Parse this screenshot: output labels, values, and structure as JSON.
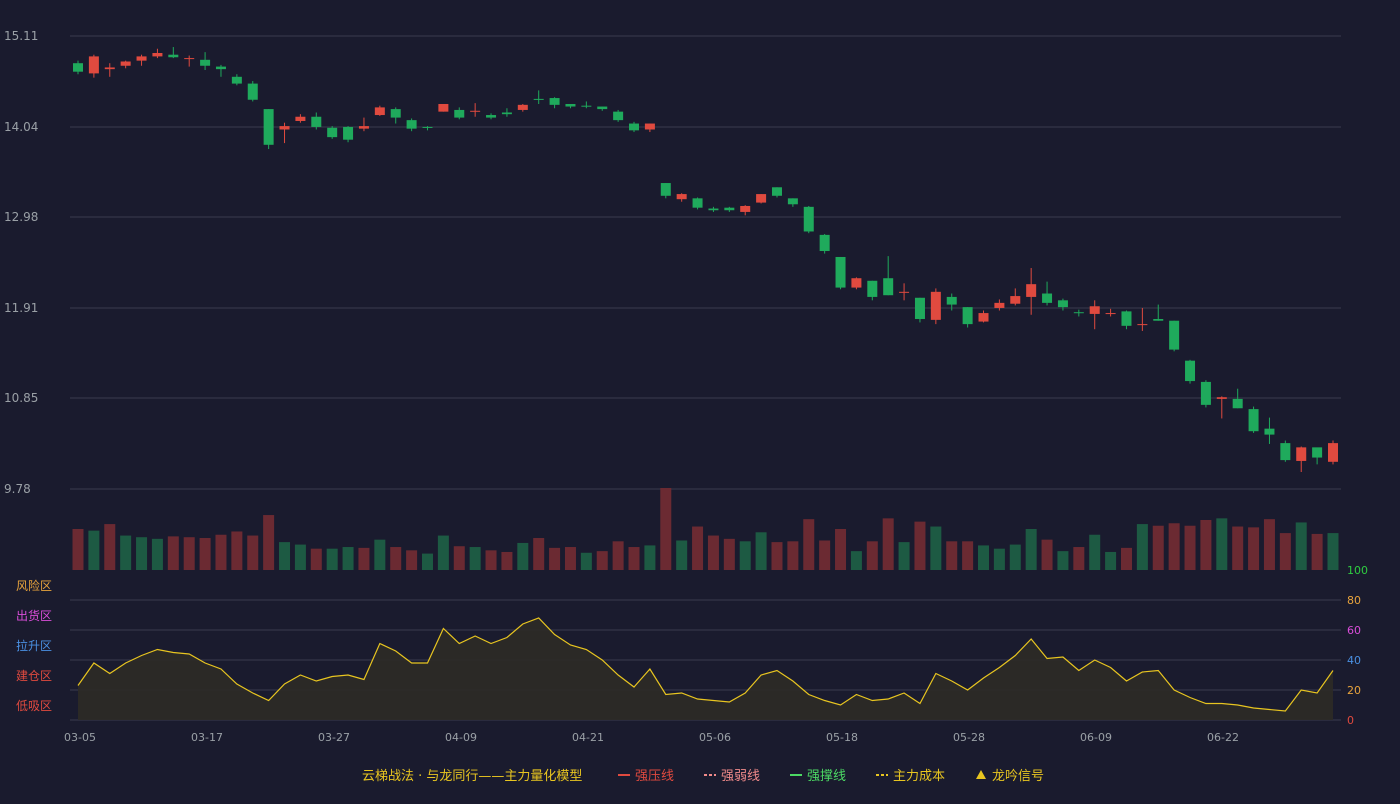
{
  "colors": {
    "background": "#1a1b2e",
    "grid": "#3a3b4e",
    "axis_text": "#9aa0a6",
    "up": "#e04a3f",
    "down": "#1faa5c",
    "vol_up": "#6b2a32",
    "vol_down": "#1d5a43",
    "osc_line": "#e8c520",
    "osc_fill": "#2e2b26"
  },
  "chart_data": [
    {
      "type": "candlestick",
      "title": "",
      "ylim": [
        9.78,
        15.11
      ],
      "yticks": [
        "15.11",
        "14.04",
        "12.98",
        "11.91",
        "10.85",
        "9.78"
      ],
      "grid": true,
      "candles": [
        [
          14.79,
          14.69,
          14.82,
          14.66
        ],
        [
          14.67,
          14.87,
          14.89,
          14.62
        ],
        [
          14.72,
          14.74,
          14.79,
          14.63
        ],
        [
          14.76,
          14.81,
          14.82,
          14.73
        ],
        [
          14.82,
          14.87,
          14.89,
          14.76
        ],
        [
          14.87,
          14.91,
          14.96,
          14.85
        ],
        [
          14.89,
          14.86,
          14.98,
          14.85
        ],
        [
          14.85,
          14.85,
          14.88,
          14.75
        ],
        [
          14.83,
          14.76,
          14.92,
          14.71
        ],
        [
          14.75,
          14.72,
          14.77,
          14.63
        ],
        [
          14.63,
          14.55,
          14.66,
          14.53
        ],
        [
          14.55,
          14.36,
          14.58,
          14.34
        ],
        [
          14.25,
          13.83,
          14.25,
          13.78
        ],
        [
          14.01,
          14.05,
          14.09,
          13.85
        ],
        [
          14.11,
          14.16,
          14.19,
          14.09
        ],
        [
          14.16,
          14.04,
          14.21,
          14.01
        ],
        [
          14.03,
          13.92,
          14.05,
          13.9
        ],
        [
          14.04,
          13.89,
          14.05,
          13.86
        ],
        [
          14.02,
          14.05,
          14.15,
          13.99
        ],
        [
          14.18,
          14.27,
          14.29,
          14.17
        ],
        [
          14.25,
          14.15,
          14.27,
          14.08
        ],
        [
          14.12,
          14.02,
          14.14,
          13.99
        ],
        [
          14.04,
          14.03,
          14.05,
          14.0
        ],
        [
          14.22,
          14.31,
          14.31,
          14.22
        ],
        [
          14.24,
          14.15,
          14.27,
          14.13
        ],
        [
          14.22,
          14.23,
          14.32,
          14.16
        ],
        [
          14.18,
          14.15,
          14.2,
          14.13
        ],
        [
          14.21,
          14.19,
          14.26,
          14.16
        ],
        [
          14.24,
          14.3,
          14.31,
          14.22
        ],
        [
          14.37,
          14.36,
          14.47,
          14.31
        ],
        [
          14.38,
          14.3,
          14.39,
          14.26
        ],
        [
          14.31,
          14.28,
          14.3,
          14.26
        ],
        [
          14.29,
          14.28,
          14.34,
          14.26
        ],
        [
          14.28,
          14.25,
          14.28,
          14.23
        ],
        [
          14.22,
          14.12,
          14.24,
          14.1
        ],
        [
          14.08,
          14.0,
          14.1,
          13.98
        ],
        [
          14.01,
          14.08,
          14.08,
          13.98
        ],
        [
          13.38,
          13.23,
          13.38,
          13.2
        ],
        [
          13.19,
          13.25,
          13.26,
          13.16
        ],
        [
          13.2,
          13.09,
          13.21,
          13.07
        ],
        [
          13.08,
          13.06,
          13.1,
          13.04
        ],
        [
          13.09,
          13.06,
          13.1,
          13.04
        ],
        [
          13.04,
          13.11,
          13.12,
          13.0
        ],
        [
          13.15,
          13.25,
          13.25,
          13.14
        ],
        [
          13.33,
          13.23,
          13.33,
          13.21
        ],
        [
          13.2,
          13.13,
          13.2,
          13.1
        ],
        [
          13.1,
          12.81,
          13.11,
          12.79
        ],
        [
          12.77,
          12.58,
          12.78,
          12.55
        ],
        [
          12.51,
          12.15,
          12.51,
          12.13
        ],
        [
          12.15,
          12.26,
          12.27,
          12.13
        ],
        [
          12.23,
          12.04,
          12.23,
          12.0
        ],
        [
          12.26,
          12.06,
          12.52,
          12.06
        ],
        [
          12.1,
          12.1,
          12.2,
          12.0
        ],
        [
          12.03,
          11.78,
          12.03,
          11.74
        ],
        [
          11.77,
          12.1,
          12.14,
          11.72
        ],
        [
          12.04,
          11.95,
          12.08,
          11.88
        ],
        [
          11.92,
          11.72,
          11.92,
          11.68
        ],
        [
          11.75,
          11.85,
          11.88,
          11.74
        ],
        [
          11.91,
          11.97,
          12.01,
          11.88
        ],
        [
          11.96,
          12.05,
          12.14,
          11.94
        ],
        [
          12.04,
          12.19,
          12.38,
          11.83
        ],
        [
          12.08,
          11.97,
          12.22,
          11.94
        ],
        [
          12.0,
          11.92,
          12.02,
          11.88
        ],
        [
          11.86,
          11.85,
          11.89,
          11.81
        ],
        [
          11.84,
          11.93,
          12.0,
          11.66
        ],
        [
          11.85,
          11.85,
          11.9,
          11.81
        ],
        [
          11.87,
          11.7,
          11.88,
          11.66
        ],
        [
          11.72,
          11.72,
          11.91,
          11.64
        ],
        [
          11.78,
          11.76,
          11.95,
          11.76
        ],
        [
          11.76,
          11.42,
          11.76,
          11.4
        ],
        [
          11.29,
          11.05,
          11.3,
          11.02
        ],
        [
          11.04,
          10.77,
          11.06,
          10.74
        ],
        [
          10.84,
          10.86,
          10.87,
          10.61
        ],
        [
          10.84,
          10.73,
          10.96,
          10.73
        ],
        [
          10.72,
          10.46,
          10.75,
          10.44
        ],
        [
          10.49,
          10.42,
          10.62,
          10.31
        ],
        [
          10.32,
          10.12,
          10.35,
          10.1
        ],
        [
          10.11,
          10.27,
          10.28,
          9.98
        ],
        [
          10.27,
          10.15,
          10.26,
          10.07
        ],
        [
          10.1,
          10.32,
          10.35,
          10.07
        ]
      ]
    },
    {
      "type": "bar",
      "title": "",
      "values": [
        [
          0.5,
          1
        ],
        [
          0.48,
          0
        ],
        [
          0.56,
          1
        ],
        [
          0.42,
          0
        ],
        [
          0.4,
          0
        ],
        [
          0.38,
          0
        ],
        [
          0.41,
          1
        ],
        [
          0.4,
          1
        ],
        [
          0.39,
          1
        ],
        [
          0.43,
          1
        ],
        [
          0.47,
          1
        ],
        [
          0.42,
          1
        ],
        [
          0.67,
          1
        ],
        [
          0.34,
          0
        ],
        [
          0.31,
          0
        ],
        [
          0.26,
          1
        ],
        [
          0.26,
          0
        ],
        [
          0.28,
          0
        ],
        [
          0.27,
          1
        ],
        [
          0.37,
          0
        ],
        [
          0.28,
          1
        ],
        [
          0.24,
          1
        ],
        [
          0.2,
          0
        ],
        [
          0.42,
          0
        ],
        [
          0.29,
          1
        ],
        [
          0.28,
          0
        ],
        [
          0.24,
          1
        ],
        [
          0.22,
          1
        ],
        [
          0.33,
          0
        ],
        [
          0.39,
          1
        ],
        [
          0.27,
          1
        ],
        [
          0.28,
          1
        ],
        [
          0.21,
          0
        ],
        [
          0.23,
          1
        ],
        [
          0.35,
          1
        ],
        [
          0.28,
          1
        ],
        [
          0.3,
          0
        ],
        [
          1.0,
          1
        ],
        [
          0.36,
          0
        ],
        [
          0.53,
          1
        ],
        [
          0.42,
          1
        ],
        [
          0.38,
          1
        ],
        [
          0.35,
          0
        ],
        [
          0.46,
          0
        ],
        [
          0.34,
          1
        ],
        [
          0.35,
          1
        ],
        [
          0.62,
          1
        ],
        [
          0.36,
          1
        ],
        [
          0.5,
          1
        ],
        [
          0.23,
          0
        ],
        [
          0.35,
          1
        ],
        [
          0.63,
          1
        ],
        [
          0.34,
          0
        ],
        [
          0.59,
          1
        ],
        [
          0.53,
          0
        ],
        [
          0.35,
          1
        ],
        [
          0.35,
          1
        ],
        [
          0.3,
          0
        ],
        [
          0.26,
          0
        ],
        [
          0.31,
          0
        ],
        [
          0.5,
          0
        ],
        [
          0.37,
          1
        ],
        [
          0.23,
          0
        ],
        [
          0.28,
          1
        ],
        [
          0.43,
          0
        ],
        [
          0.22,
          0
        ],
        [
          0.27,
          1
        ],
        [
          0.56,
          0
        ],
        [
          0.54,
          1
        ],
        [
          0.57,
          1
        ],
        [
          0.54,
          1
        ],
        [
          0.61,
          1
        ],
        [
          0.63,
          0
        ],
        [
          0.53,
          1
        ],
        [
          0.52,
          1
        ],
        [
          0.62,
          1
        ],
        [
          0.45,
          1
        ],
        [
          0.58,
          0
        ],
        [
          0.44,
          1
        ],
        [
          0.45,
          0
        ]
      ]
    },
    {
      "type": "area",
      "title": "",
      "ylim": [
        0,
        100
      ],
      "yticks": [
        "100",
        "80",
        "60",
        "40",
        "20",
        "0"
      ],
      "tick_colors": [
        "#2ecc40",
        "#e8a33c",
        "#d94dd9",
        "#4a90e2",
        "#e8a33c",
        "#e04a3f"
      ],
      "zones": [
        {
          "label": "风险区",
          "color": "#e8a33c"
        },
        {
          "label": "出货区",
          "color": "#d94dd9"
        },
        {
          "label": "拉升区",
          "color": "#4a90e2"
        },
        {
          "label": "建仓区",
          "color": "#e04a3f"
        },
        {
          "label": "低吸区",
          "color": "#e04a3f"
        }
      ],
      "x_labels": [
        "03-05",
        "03-17",
        "03-27",
        "04-09",
        "04-21",
        "05-06",
        "05-18",
        "05-28",
        "06-09",
        "06-22"
      ],
      "values": [
        23,
        38,
        31,
        38,
        43,
        47,
        45,
        44,
        38,
        34,
        24,
        18,
        13,
        24,
        30,
        26,
        29,
        30,
        27,
        51,
        46,
        38,
        38,
        61,
        51,
        56,
        51,
        55,
        64,
        68,
        57,
        50,
        47,
        40,
        30,
        22,
        34,
        17,
        18,
        14,
        13,
        12,
        18,
        30,
        33,
        26,
        17,
        13,
        10,
        17,
        13,
        14,
        18,
        11,
        31,
        26,
        20,
        28,
        35,
        43,
        54,
        41,
        42,
        33,
        40,
        35,
        26,
        32,
        33,
        20,
        15,
        11,
        11,
        10,
        8,
        7,
        6,
        20,
        18,
        33
      ]
    }
  ],
  "legend": {
    "title": "云梯战法 · 与龙同行——主力量化模型",
    "items": [
      {
        "label": "强压线",
        "color": "#e04a3f",
        "style": "solid"
      },
      {
        "label": "强弱线",
        "color": "#f08a8a",
        "style": "dashed"
      },
      {
        "label": "强撑线",
        "color": "#4cd964",
        "style": "solid"
      },
      {
        "label": "主力成本",
        "color": "#e8c520",
        "style": "dashed"
      },
      {
        "label": "龙吟信号",
        "color": "#e8c520",
        "style": "triangle"
      }
    ]
  }
}
